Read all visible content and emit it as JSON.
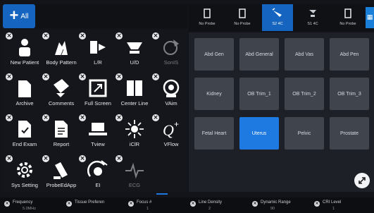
{
  "top_bar": {
    "all_tab_label": "All"
  },
  "tools": [
    {
      "label": "New Patient",
      "icon": "person-icon",
      "enabled": true
    },
    {
      "label": "Body Pattern",
      "icon": "body-pattern-icon",
      "enabled": true
    },
    {
      "label": "L/R",
      "icon": "left-right-icon",
      "enabled": true
    },
    {
      "label": "U/D",
      "icon": "up-down-icon",
      "enabled": true
    },
    {
      "label": "SonIS",
      "icon": "sonis-icon",
      "enabled": false
    },
    {
      "label": "Archive",
      "icon": "archive-icon",
      "enabled": true
    },
    {
      "label": "Comments",
      "icon": "comments-icon",
      "enabled": true
    },
    {
      "label": "Full Screen",
      "icon": "full-screen-icon",
      "enabled": true
    },
    {
      "label": "Center Line",
      "icon": "center-line-icon",
      "enabled": true
    },
    {
      "label": "VAim",
      "icon": "vaim-icon",
      "enabled": true
    },
    {
      "label": "End Exam",
      "icon": "end-exam-icon",
      "enabled": true
    },
    {
      "label": "Report",
      "icon": "report-icon",
      "enabled": true
    },
    {
      "label": "Tview",
      "icon": "tview-icon",
      "enabled": true
    },
    {
      "label": "iClR",
      "icon": "iclr-icon",
      "enabled": true
    },
    {
      "label": "VFlow",
      "icon": "vflow-icon",
      "enabled": true
    },
    {
      "label": "Sys Setting",
      "icon": "settings-gear-icon",
      "enabled": true
    },
    {
      "label": "ProbeEdApp",
      "icon": "probe-app-icon",
      "enabled": true
    },
    {
      "label": "EI",
      "icon": "ei-icon",
      "enabled": true
    },
    {
      "label": "ECG",
      "icon": "ecg-icon",
      "enabled": false
    }
  ],
  "probes": [
    {
      "label": "No Probe",
      "active": false
    },
    {
      "label": "No Probe",
      "active": false
    },
    {
      "label": "S2 4C",
      "active": true
    },
    {
      "label": "S1 4C",
      "active": false
    },
    {
      "label": "No Probe",
      "active": false
    }
  ],
  "presets": [
    "Abd Gen",
    "Abd General",
    "Abd Vas",
    "Abd Pen",
    "Kidney",
    "OB Trim_1",
    "OB Trim_2",
    "OB Trim_3",
    "Fetal Heart",
    "Uterus",
    "Pelvic",
    "Prostate"
  ],
  "selected_preset": "Uterus",
  "params": [
    {
      "name": "Frequency",
      "value": "5.0MHz"
    },
    {
      "name": "Tissue Preferen",
      "value": ""
    },
    {
      "name": "Focus #",
      "value": "1"
    },
    {
      "name": "Line Density",
      "value": "2"
    },
    {
      "name": "Dynamic Range",
      "value": "90"
    },
    {
      "name": "CRI Level",
      "value": "1"
    }
  ],
  "colors": {
    "accent": "#1e7ae0",
    "tab_active": "#1565c0"
  }
}
